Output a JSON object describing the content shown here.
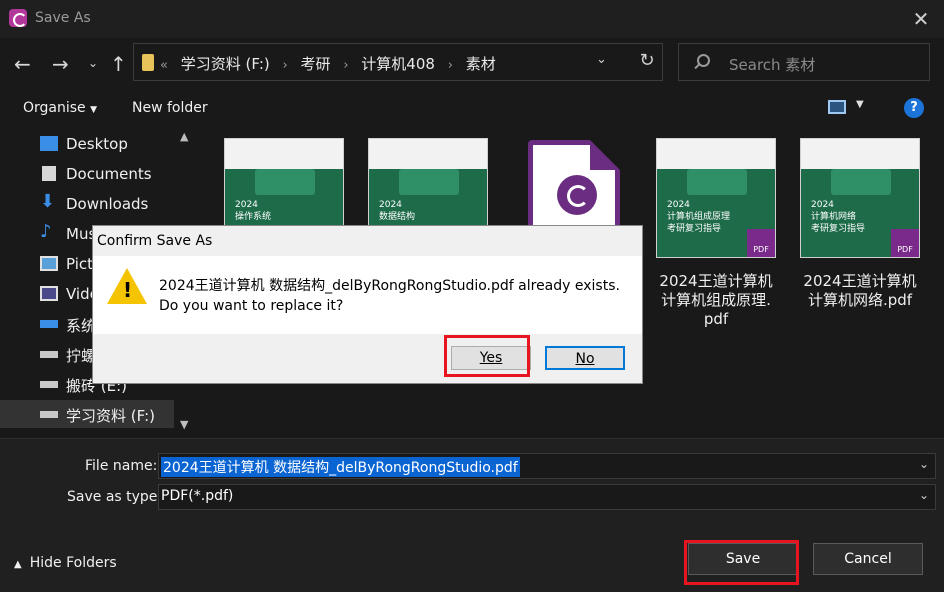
{
  "window": {
    "title": "Save As",
    "app_icon": "foxit-icon",
    "close_icon": "close-icon"
  },
  "nav": {
    "back_icon": "arrow-left-icon",
    "forward_icon": "arrow-right-icon",
    "recent_icon": "chevron-down-icon",
    "up_icon": "arrow-up-icon",
    "breadcrumb": [
      "学习资料 (F:)",
      "考研",
      "计算机408",
      "素材"
    ],
    "overflow": "«",
    "search_placeholder": "Search 素材"
  },
  "commands": {
    "organise": "Organise",
    "new_folder": "New folder",
    "help": "?"
  },
  "sidebar": {
    "items": [
      {
        "label": "Desktop",
        "icon": "desktop-icon"
      },
      {
        "label": "Documents",
        "icon": "documents-icon"
      },
      {
        "label": "Downloads",
        "icon": "download-icon"
      },
      {
        "label": "Musi",
        "icon": "music-icon"
      },
      {
        "label": "Pictu",
        "icon": "pictures-icon"
      },
      {
        "label": "Vide",
        "icon": "videos-icon"
      },
      {
        "label": "系统",
        "icon": "drive-icon"
      },
      {
        "label": "拧螺",
        "icon": "drive-icon"
      },
      {
        "label": "搬砖 (E:)",
        "icon": "drive-icon"
      },
      {
        "label": "学习资料 (F:)",
        "icon": "drive-icon",
        "selected": true
      }
    ]
  },
  "files": [
    {
      "cover_title": "2024\n操作系统",
      "label": ""
    },
    {
      "cover_title": "2024\n数据结构",
      "label": ""
    },
    {
      "type": "foxit-document",
      "label": ""
    },
    {
      "cover_title": "2024\n计算机组成原理\n考研复习指导",
      "label": "2024王道计算机\n计算机组成原理.\npdf",
      "badge": "PDF"
    },
    {
      "cover_title": "2024\n计算机网络\n考研复习指导",
      "label": "2024王道计算机\n计算机网络.pdf",
      "badge": "PDF"
    }
  ],
  "footer": {
    "file_name_label": "File name:",
    "file_name_value": "2024王道计算机 数据结构_delByRongRongStudio.pdf",
    "save_type_label": "Save as type:",
    "save_type_value": "PDF(*.pdf)",
    "hide_folders": "Hide Folders",
    "save": "Save",
    "cancel": "Cancel"
  },
  "dialog": {
    "title": "Confirm Save As",
    "message_line1": "2024王道计算机 数据结构_delByRongRongStudio.pdf already exists.",
    "message_line2": "Do you want to replace it?",
    "yes": "Yes",
    "no": "No",
    "icon": "warning-icon"
  },
  "colors": {
    "highlight_frame": "#e8141f",
    "selection": "#0a64d2",
    "warning": "#f5c400"
  }
}
